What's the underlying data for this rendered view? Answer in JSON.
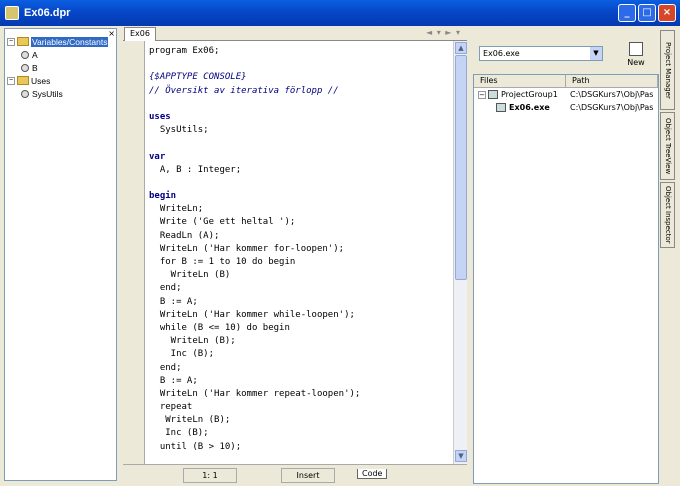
{
  "window": {
    "title": "Ex06.dpr",
    "buttons": [
      "_",
      "□",
      "×"
    ]
  },
  "left": {
    "tree": [
      {
        "label": "Variables/Constants",
        "level": 0,
        "sel": true,
        "kind": "folder"
      },
      {
        "label": "A",
        "level": 1,
        "kind": "var"
      },
      {
        "label": "B",
        "level": 1,
        "kind": "var"
      },
      {
        "label": "Uses",
        "level": 0,
        "kind": "folder"
      },
      {
        "label": "SysUtils",
        "level": 1,
        "kind": "unit"
      }
    ]
  },
  "editor": {
    "tab": "Ex06",
    "code": [
      {
        "t": "program Ex06;"
      },
      {
        "t": ""
      },
      {
        "t": "{$APPTYPE CONSOLE}",
        "c": "c"
      },
      {
        "t": "// Översikt av iterativa förlopp //",
        "c": "c"
      },
      {
        "t": ""
      },
      {
        "t": "uses",
        "c": "k"
      },
      {
        "t": "  SysUtils;"
      },
      {
        "t": ""
      },
      {
        "t": "var",
        "c": "k"
      },
      {
        "t": "  A, B : Integer;"
      },
      {
        "t": ""
      },
      {
        "t": "begin",
        "c": "k"
      },
      {
        "t": "  WriteLn;"
      },
      {
        "t": "  Write ('Ge ett heltal ');"
      },
      {
        "t": "  ReadLn (A);"
      },
      {
        "t": "  WriteLn ('Har kommer for-loopen');"
      },
      {
        "t": "  for B := 1 to 10 do begin"
      },
      {
        "t": "    WriteLn (B)"
      },
      {
        "t": "  end;"
      },
      {
        "t": "  B := A;"
      },
      {
        "t": "  WriteLn ('Har kommer while-loopen');"
      },
      {
        "t": "  while (B <= 10) do begin"
      },
      {
        "t": "    WriteLn (B);"
      },
      {
        "t": "    Inc (B);"
      },
      {
        "t": "  end;"
      },
      {
        "t": "  B := A;"
      },
      {
        "t": "  WriteLn ('Har kommer repeat-loopen');"
      },
      {
        "t": "  repeat"
      },
      {
        "t": "   WriteLn (B);"
      },
      {
        "t": "   Inc (B);"
      },
      {
        "t": "  until (B > 10);"
      }
    ],
    "status": {
      "position": "1: 1",
      "mode": "Insert",
      "codetab": "Code"
    }
  },
  "project": {
    "combo": "Ex06.exe",
    "new": "New",
    "cols": [
      "Files",
      "Path"
    ],
    "rows": [
      {
        "name": "ProjectGroup1",
        "path": "C:\\DSGKurs7\\Obj\\Pas",
        "level": 0
      },
      {
        "name": "Ex06.exe",
        "path": "C:\\DSGKurs7\\Obj\\Pas",
        "level": 1,
        "bold": true
      }
    ]
  },
  "sidetabs": [
    "Project Manager",
    "Object TreeView",
    "Object Inspector"
  ]
}
